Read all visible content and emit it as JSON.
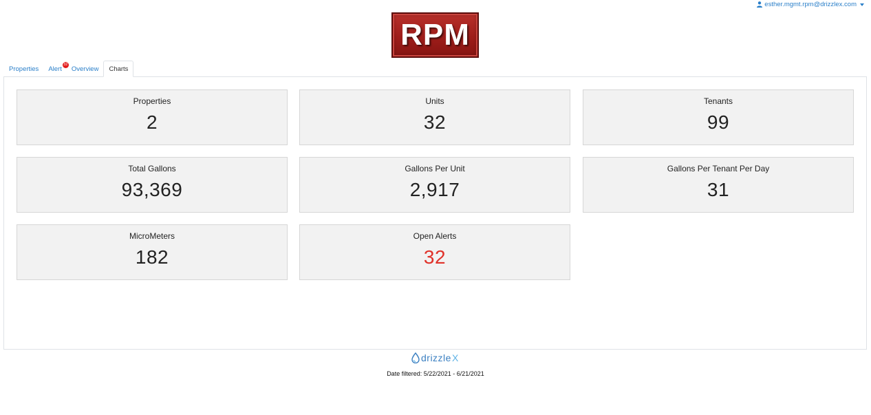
{
  "user": {
    "email": "esther.mgmt.rpm@drizzlex.com",
    "icon": "user-icon"
  },
  "logo": {
    "text": "RPM"
  },
  "tabs": [
    {
      "label": "Properties",
      "active": false
    },
    {
      "label": "Alert",
      "active": false,
      "badge": "32"
    },
    {
      "label": "Overview",
      "active": false
    },
    {
      "label": "Charts",
      "active": true
    }
  ],
  "cards": [
    {
      "label": "Properties",
      "value": "2"
    },
    {
      "label": "Units",
      "value": "32"
    },
    {
      "label": "Tenants",
      "value": "99"
    },
    {
      "label": "Total Gallons",
      "value": "93,369"
    },
    {
      "label": "Gallons Per Unit",
      "value": "2,917"
    },
    {
      "label": "Gallons Per Tenant Per Day",
      "value": "31"
    },
    {
      "label": "MicroMeters",
      "value": "182"
    },
    {
      "label": "Open Alerts",
      "value": "32",
      "value_color": "#e0322a"
    }
  ],
  "footer": {
    "brand_main": "drizzle",
    "brand_x": "X",
    "date_filtered": "Date filtered: 5/22/2021 - 6/21/2021"
  },
  "colors": {
    "link": "#2a7fc9",
    "alert": "#e0322a",
    "card_bg": "#f2f2f2"
  }
}
